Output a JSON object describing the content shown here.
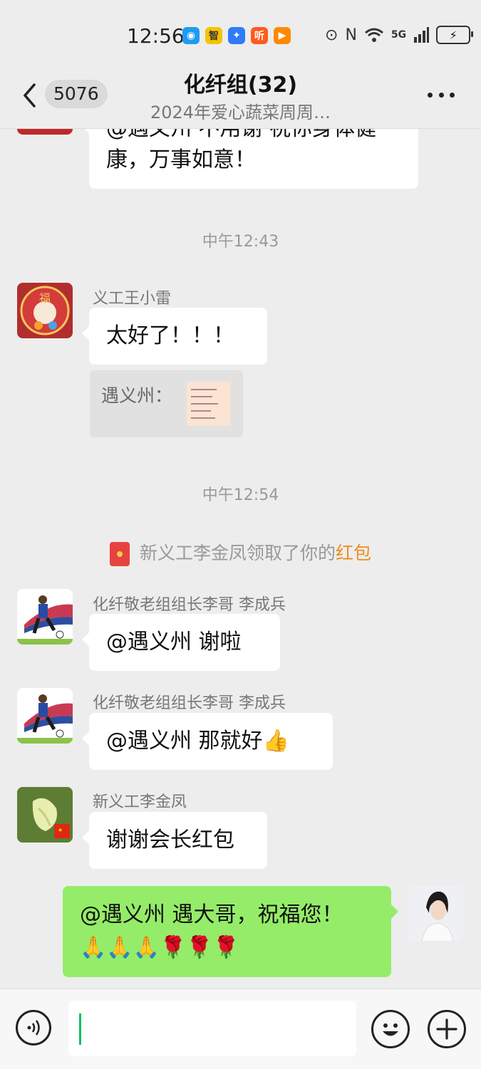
{
  "status_bar": {
    "time": "12:56",
    "apps": [
      {
        "name": "chat-bubble-app-icon",
        "color": "#1e9bf0",
        "glyph": "◉"
      },
      {
        "name": "news-app-icon",
        "color": "#f5c400",
        "glyph": "智"
      },
      {
        "name": "map-app-icon",
        "color": "#2f7cf6",
        "glyph": "✦"
      },
      {
        "name": "listen-app-icon",
        "color": "#ff5a1f",
        "glyph": "听"
      },
      {
        "name": "video-app-icon",
        "color": "#ff8a00",
        "glyph": "▶"
      }
    ],
    "signal_label": "5G"
  },
  "header": {
    "unread_count": "5076",
    "title": "化纤组(32)",
    "subtitle": "2024年爱心蔬菜周周…"
  },
  "messages": {
    "m0_text": "@遇义州 不用谢 祝你身体健康，万事如意！",
    "time1": "中午12:43",
    "m1_sender": "义工王小雷",
    "m1_text": "太好了！！！",
    "m1_quote_label": "遇义州：",
    "time2": "中午12:54",
    "system_prefix": "新义工李金凤领取了你的",
    "system_highlight": "红包",
    "m2_sender": "化纤敬老组组长李哥 李成兵",
    "m2_text": "@遇义州  谢啦",
    "m3_sender": "化纤敬老组组长李哥 李成兵",
    "m3_text": "@遇义州  那就好👍",
    "m4_sender": "新义工李金凤",
    "m4_text": "谢谢会长红包",
    "m5_text_line1": "@遇义州  遇大哥，祝福您！",
    "m5_text_line2": "🙏🙏🙏🌹🌹🌹"
  },
  "colors": {
    "background": "#ededed",
    "my_bubble": "#95ec69",
    "other_bubble": "#ffffff",
    "highlight": "#f08c1e",
    "caret": "#07c160"
  }
}
